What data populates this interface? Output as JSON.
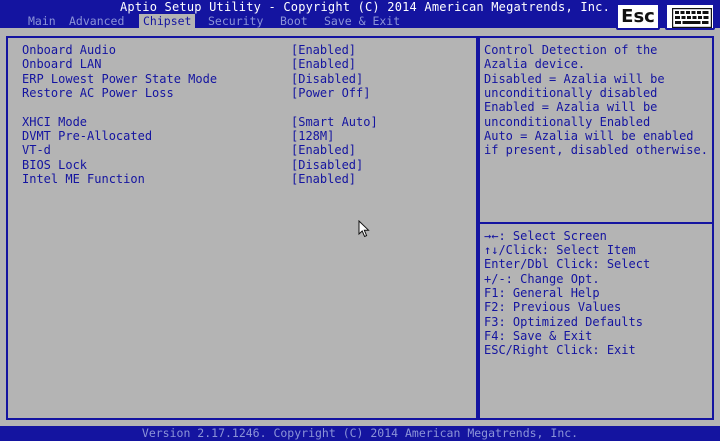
{
  "header": {
    "title": "Aptio Setup Utility - Copyright (C) 2014 American Megatrends, Inc.",
    "tabs": [
      {
        "label": "Main",
        "active": false
      },
      {
        "label": "Advanced",
        "active": false
      },
      {
        "label": "Chipset",
        "active": true
      },
      {
        "label": "Security",
        "active": false
      },
      {
        "label": "Boot",
        "active": false
      },
      {
        "label": "Save & Exit",
        "active": false
      }
    ],
    "esc_label": "Esc"
  },
  "settings": [
    {
      "label": "Onboard Audio",
      "value": "[Enabled]"
    },
    {
      "label": "Onboard LAN",
      "value": "[Enabled]"
    },
    {
      "label": "ERP Lowest Power State Mode",
      "value": "[Disabled]"
    },
    {
      "label": "Restore AC Power Loss",
      "value": "[Power Off]"
    },
    {
      "label": "XHCI Mode",
      "value": "[Smart Auto]"
    },
    {
      "label": "DVMT Pre-Allocated",
      "value": "[128M]"
    },
    {
      "label": "VT-d",
      "value": "[Enabled]"
    },
    {
      "label": "BIOS Lock",
      "value": "[Disabled]"
    },
    {
      "label": "Intel ME Function",
      "value": "[Enabled]"
    }
  ],
  "help": {
    "description": [
      "Control Detection of the",
      "Azalia device.",
      "Disabled = Azalia will be",
      "unconditionally disabled",
      "Enabled = Azalia will be",
      "unconditionally Enabled",
      "Auto = Azalia will be enabled",
      "if present, disabled otherwise."
    ],
    "keys": [
      "→←: Select Screen",
      "↑↓/Click: Select Item",
      "Enter/Dbl Click: Select",
      "+/-: Change Opt.",
      "F1: General Help",
      "F2: Previous Values",
      "F3: Optimized Defaults",
      "F4: Save & Exit",
      "ESC/Right Click: Exit"
    ]
  },
  "footer": {
    "text": "Version 2.17.1246. Copyright (C) 2014 American Megatrends, Inc."
  },
  "colors": {
    "accent": "#1414a0",
    "background": "#b4b4b4",
    "inactive_tab": "#8c94d8",
    "title_text": "#ffffff"
  },
  "icons": {
    "esc": "esc-key-icon",
    "keyboard": "keyboard-icon",
    "cursor": "mouse-pointer-icon"
  }
}
